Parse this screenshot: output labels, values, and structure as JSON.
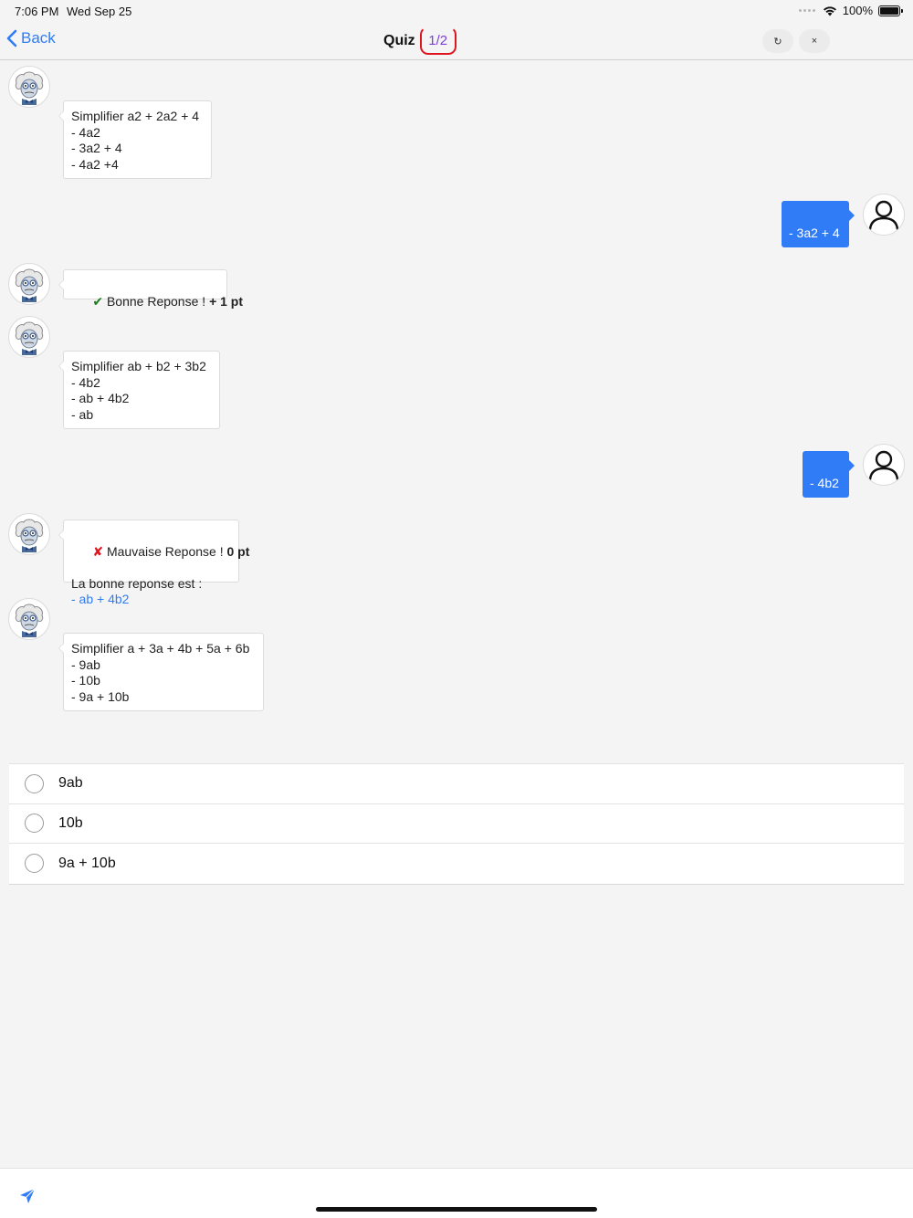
{
  "status_bar": {
    "time": "7:06 PM",
    "date": "Wed Sep 25",
    "battery": "100%"
  },
  "nav": {
    "back_label": "Back",
    "title": "Quiz",
    "progress": "1/2",
    "refresh_icon": "refresh-icon",
    "close_icon": "close-icon",
    "close_glyph": "×",
    "refresh_glyph": "↻"
  },
  "messages": {
    "q1": {
      "lines": [
        "Simplifier a2 + 2a2 + 4",
        "- 4a2",
        "- 3a2 + 4",
        "- 4a2 +4"
      ]
    },
    "a1": {
      "text": "- 3a2 + 4"
    },
    "r1": {
      "check": "✔",
      "text": " Bonne Reponse ! ",
      "points": "+ 1 pt"
    },
    "q2": {
      "lines": [
        "Simplifier ab + b2 + 3b2",
        "- 4b2",
        "- ab + 4b2",
        "- ab"
      ]
    },
    "a2": {
      "text": "- 4b2"
    },
    "r2": {
      "cross": "✘",
      "text": " Mauvaise Reponse ! ",
      "points": "0 pt",
      "line2": "La bonne reponse est :",
      "correct": "- ab + 4b2"
    },
    "q3": {
      "lines": [
        "Simplifier a + 3a + 4b + 5a + 6b",
        "- 9ab",
        "- 10b",
        "- 9a + 10b"
      ]
    }
  },
  "options": [
    {
      "label": "9ab"
    },
    {
      "label": "10b"
    },
    {
      "label": "9a + 10b"
    }
  ],
  "colors": {
    "accent": "#2f7cf6",
    "correct": "#1f7a1f",
    "wrong": "#e0141e",
    "progress": "#7b3fd6"
  }
}
